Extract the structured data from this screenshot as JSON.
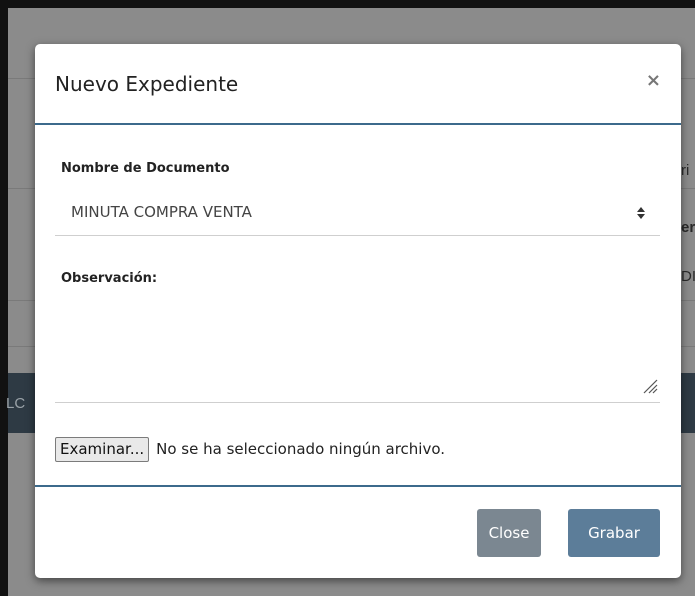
{
  "background": {
    "partial_texts": [
      "ri",
      "era",
      "DI",
      "LC"
    ]
  },
  "modal": {
    "title": "Nuevo Expediente",
    "close_icon": "×",
    "document_label": "Nombre de Documento",
    "document_value": "MINUTA COMPRA VENTA",
    "observation_label": "Observación:",
    "observation_value": "",
    "browse_label": "Examinar...",
    "file_status": "No se ha seleccionado ningún archivo.",
    "close_button": "Close",
    "save_button": "Grabar"
  },
  "colors": {
    "header_rule": "#3c6a8c",
    "close_button_bg": "#7b8791",
    "save_button_bg": "#5c7d99",
    "backdrop": "#8b8b8b"
  },
  "icons": {
    "dialog_close": "close-icon",
    "select_arrows": "sort-icon",
    "textarea_resize": "resize-grip-icon"
  }
}
